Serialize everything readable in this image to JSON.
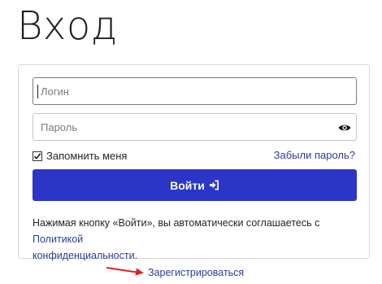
{
  "page": {
    "title": "Вход"
  },
  "form": {
    "login_placeholder": "Логин",
    "login_value": "",
    "password_placeholder": "Пароль",
    "password_value": "",
    "remember_label": "Запомнить меня",
    "remember_checked": true,
    "forgot_link": "Забыли пароль?",
    "submit_label": "Войти",
    "submit_icon": "sign-in-icon",
    "password_toggle_icon": "eye-icon"
  },
  "agreement": {
    "text": "Нажимая кнопку «Войти», вы автоматически соглашаетесь с ",
    "link_part1": "Политикой",
    "link_part2": "конфиденциальности",
    "suffix": "."
  },
  "footer": {
    "register_link": "Зарегистрироваться",
    "pointer_icon": "arrow-right-icon"
  },
  "colors": {
    "accent": "#2b36c6",
    "link": "#2a3c9e",
    "annotation_arrow": "#e02020"
  }
}
